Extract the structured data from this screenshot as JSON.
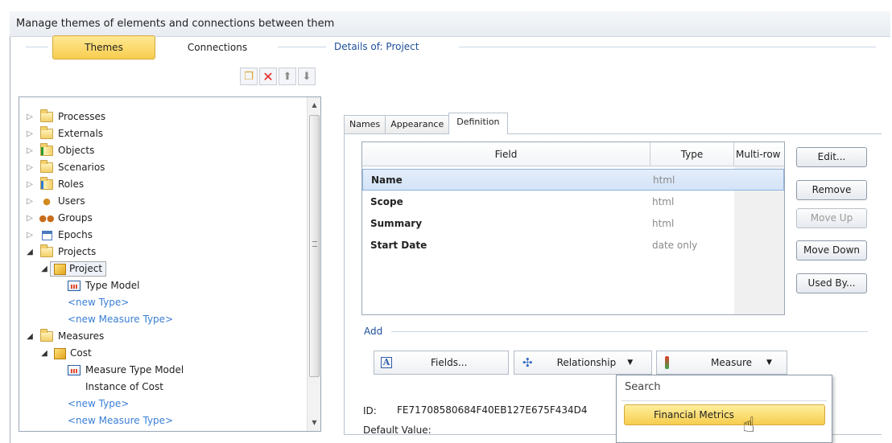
{
  "window": {
    "title": "Manage themes of elements and connections between them"
  },
  "tabs": {
    "themes": "Themes",
    "connections": "Connections"
  },
  "details": {
    "title": "Details of: Project"
  },
  "tree": {
    "items": [
      {
        "label": "Processes"
      },
      {
        "label": "Externals"
      },
      {
        "label": "Objects"
      },
      {
        "label": "Scenarios"
      },
      {
        "label": "Roles"
      },
      {
        "label": "Users"
      },
      {
        "label": "Groups"
      },
      {
        "label": "Epochs"
      },
      {
        "label": "Projects"
      },
      {
        "label": "Project"
      },
      {
        "label": "Type Model"
      },
      {
        "label": "<new Type>"
      },
      {
        "label": "<new Measure Type>"
      },
      {
        "label": "Measures"
      },
      {
        "label": "Cost"
      },
      {
        "label": "Measure Type Model"
      },
      {
        "label": "Instance of Cost"
      },
      {
        "label": "<new Type>"
      },
      {
        "label": "<new Measure Type>"
      }
    ]
  },
  "panel_tabs": {
    "names": "Names",
    "appearance": "Appearance",
    "definition": "Definition"
  },
  "grid": {
    "headers": {
      "field": "Field",
      "type": "Type",
      "multi": "Multi-row"
    },
    "rows": [
      {
        "field": "Name",
        "type": "html"
      },
      {
        "field": "Scope",
        "type": "html"
      },
      {
        "field": "Summary",
        "type": "html"
      },
      {
        "field": "Start Date",
        "type": "date only"
      }
    ]
  },
  "buttons": {
    "edit": "Edit...",
    "remove": "Remove",
    "move_up": "Move Up",
    "move_down": "Move Down",
    "used_by": "Used By..."
  },
  "add": {
    "label": "Add",
    "fields": "Fields...",
    "relationship": "Relationship",
    "measure": "Measure"
  },
  "id": {
    "label": "ID:",
    "value": "FE71708580684F40EB127E675F434D4"
  },
  "default_value": {
    "label": "Default Value:"
  },
  "dropdown": {
    "search_placeholder": "Search",
    "item": "Financial Metrics"
  },
  "colors": {
    "accent_yellow": "#f8cd4f",
    "link_blue": "#3a7fd5",
    "section_blue": "#1d4e9b"
  }
}
